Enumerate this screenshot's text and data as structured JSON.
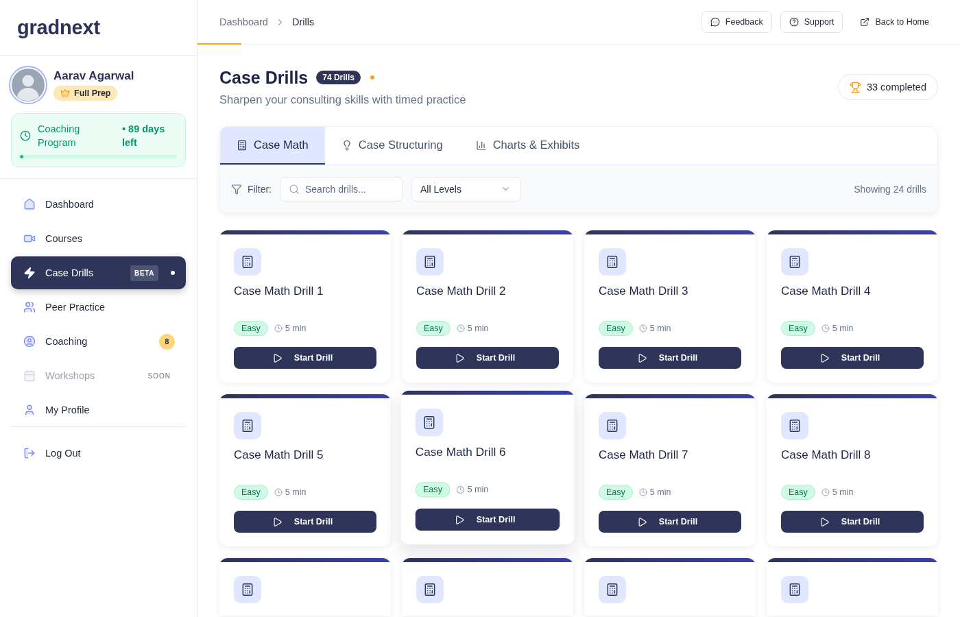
{
  "sidebar": {
    "logo": "gradnext",
    "user": {
      "name": "Aarav Agarwal",
      "plan": "Full Prep"
    },
    "program": {
      "label": "Coaching Program",
      "remaining": "• 89 days left",
      "level": 0.02
    },
    "nav": [
      {
        "label": "Dashboard",
        "selected": false,
        "disabled": false
      },
      {
        "label": "Courses",
        "selected": false,
        "disabled": false
      },
      {
        "label": "Case Drills",
        "selected": true,
        "disabled": false,
        "badge": "BETA"
      },
      {
        "label": "Peer Practice",
        "selected": false,
        "disabled": false
      },
      {
        "label": "Coaching",
        "selected": false,
        "disabled": false,
        "count": "8"
      },
      {
        "label": "Workshops",
        "selected": false,
        "disabled": true,
        "tag": "SOON"
      },
      {
        "label": "My Profile",
        "selected": false,
        "disabled": false
      }
    ],
    "footer_nav": [
      {
        "label": "Log Out",
        "selected": false,
        "disabled": false
      }
    ]
  },
  "header": {
    "breadcrumb": [
      {
        "label": "Dashboard",
        "current": false
      },
      {
        "label": "Drills",
        "current": true
      }
    ],
    "actions": [
      {
        "label": "Feedback",
        "kind": "outlined"
      },
      {
        "label": "Support",
        "kind": "outlined"
      },
      {
        "label": "Back to Home",
        "kind": "link"
      }
    ]
  },
  "page": {
    "title": "Case Drills",
    "count_badge": "74 Drills",
    "subtitle": "Sharpen your consulting skills with timed practice",
    "completed": "33 completed"
  },
  "tabs": [
    {
      "label": "Case Math",
      "selected": true
    },
    {
      "label": "Case Structuring",
      "selected": false
    },
    {
      "label": "Charts & Exhibits",
      "selected": false
    }
  ],
  "filter": {
    "label": "Filter:",
    "search": {
      "placeholder": "Search drills..."
    },
    "level_select": "All Levels",
    "result_count": "Showing 24 drills"
  },
  "cards": [
    {
      "kind": "full",
      "title": "Case Math Drill 1",
      "difficulty": "Easy",
      "duration": "5 min",
      "action": "Start Drill",
      "hovered": false
    },
    {
      "kind": "full",
      "title": "Case Math Drill 2",
      "difficulty": "Easy",
      "duration": "5 min",
      "action": "Start Drill",
      "hovered": false
    },
    {
      "kind": "full",
      "title": "Case Math Drill 3",
      "difficulty": "Easy",
      "duration": "5 min",
      "action": "Start Drill",
      "hovered": false
    },
    {
      "kind": "full",
      "title": "Case Math Drill 4",
      "difficulty": "Easy",
      "duration": "5 min",
      "action": "Start Drill",
      "hovered": false
    },
    {
      "kind": "full",
      "title": "Case Math Drill 5",
      "difficulty": "Easy",
      "duration": "5 min",
      "action": "Start Drill",
      "hovered": false
    },
    {
      "kind": "full",
      "title": "Case Math Drill 6",
      "difficulty": "Easy",
      "duration": "5 min",
      "action": "Start Drill",
      "hovered": true
    },
    {
      "kind": "full",
      "title": "Case Math Drill 7",
      "difficulty": "Easy",
      "duration": "5 min",
      "action": "Start Drill",
      "hovered": false
    },
    {
      "kind": "full",
      "title": "Case Math Drill 8",
      "difficulty": "Easy",
      "duration": "5 min",
      "action": "Start Drill",
      "hovered": false
    },
    {
      "kind": "partial"
    },
    {
      "kind": "partial"
    },
    {
      "kind": "partial"
    },
    {
      "kind": "partial"
    }
  ]
}
